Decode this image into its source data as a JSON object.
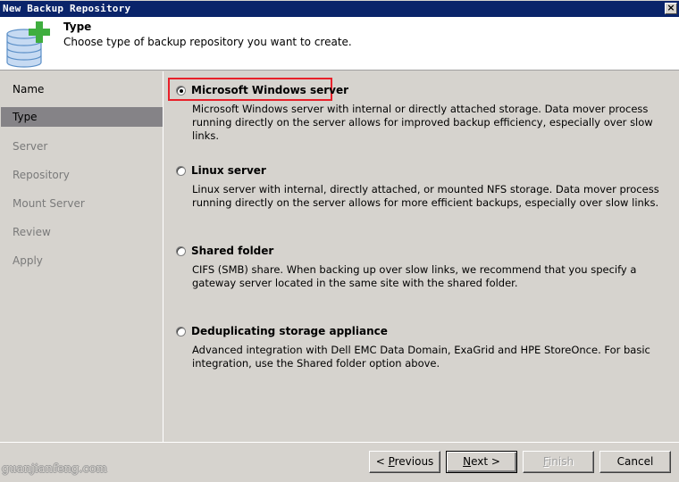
{
  "window": {
    "title": "New Backup Repository",
    "close_label": "×"
  },
  "header": {
    "title": "Type",
    "subtitle": "Choose type of backup repository you want to create.",
    "icon": "database-add-icon"
  },
  "sidebar": {
    "items": [
      {
        "label": "Name",
        "state": "done"
      },
      {
        "label": "Type",
        "state": "active"
      },
      {
        "label": "Server",
        "state": "pending"
      },
      {
        "label": "Repository",
        "state": "pending"
      },
      {
        "label": "Mount Server",
        "state": "pending"
      },
      {
        "label": "Review",
        "state": "pending"
      },
      {
        "label": "Apply",
        "state": "pending"
      }
    ]
  },
  "options": [
    {
      "label": "Microsoft Windows server",
      "description": "Microsoft Windows server with internal or directly attached storage. Data mover process running directly on the server allows for improved backup efficiency, especially over slow links.",
      "selected": true,
      "highlighted": true
    },
    {
      "label": "Linux server",
      "description": "Linux server with internal, directly attached, or mounted NFS storage. Data mover process running directly on the server allows for more efficient backups, especially over slow links.",
      "selected": false
    },
    {
      "label": "Shared folder",
      "description": "CIFS (SMB) share. When backing up over slow links, we recommend that you specify a gateway server located in the same site with the shared folder.",
      "selected": false
    },
    {
      "label": "Deduplicating storage appliance",
      "description": "Advanced integration with Dell EMC Data Domain, ExaGrid and HPE StoreOnce. For basic integration, use the Shared folder option above.",
      "selected": false
    }
  ],
  "buttons": {
    "previous": {
      "prefix": "< ",
      "mnemonic": "P",
      "rest": "revious"
    },
    "next": {
      "mnemonic": "N",
      "rest": "ext >"
    },
    "finish": {
      "mnemonic": "F",
      "rest": "inish",
      "disabled": true
    },
    "cancel": {
      "label": "Cancel"
    }
  },
  "colors": {
    "titlebar": "#0a246a",
    "highlight": "#e8202a",
    "active_step": "#858387"
  },
  "watermark": "guanjianfeng.com"
}
